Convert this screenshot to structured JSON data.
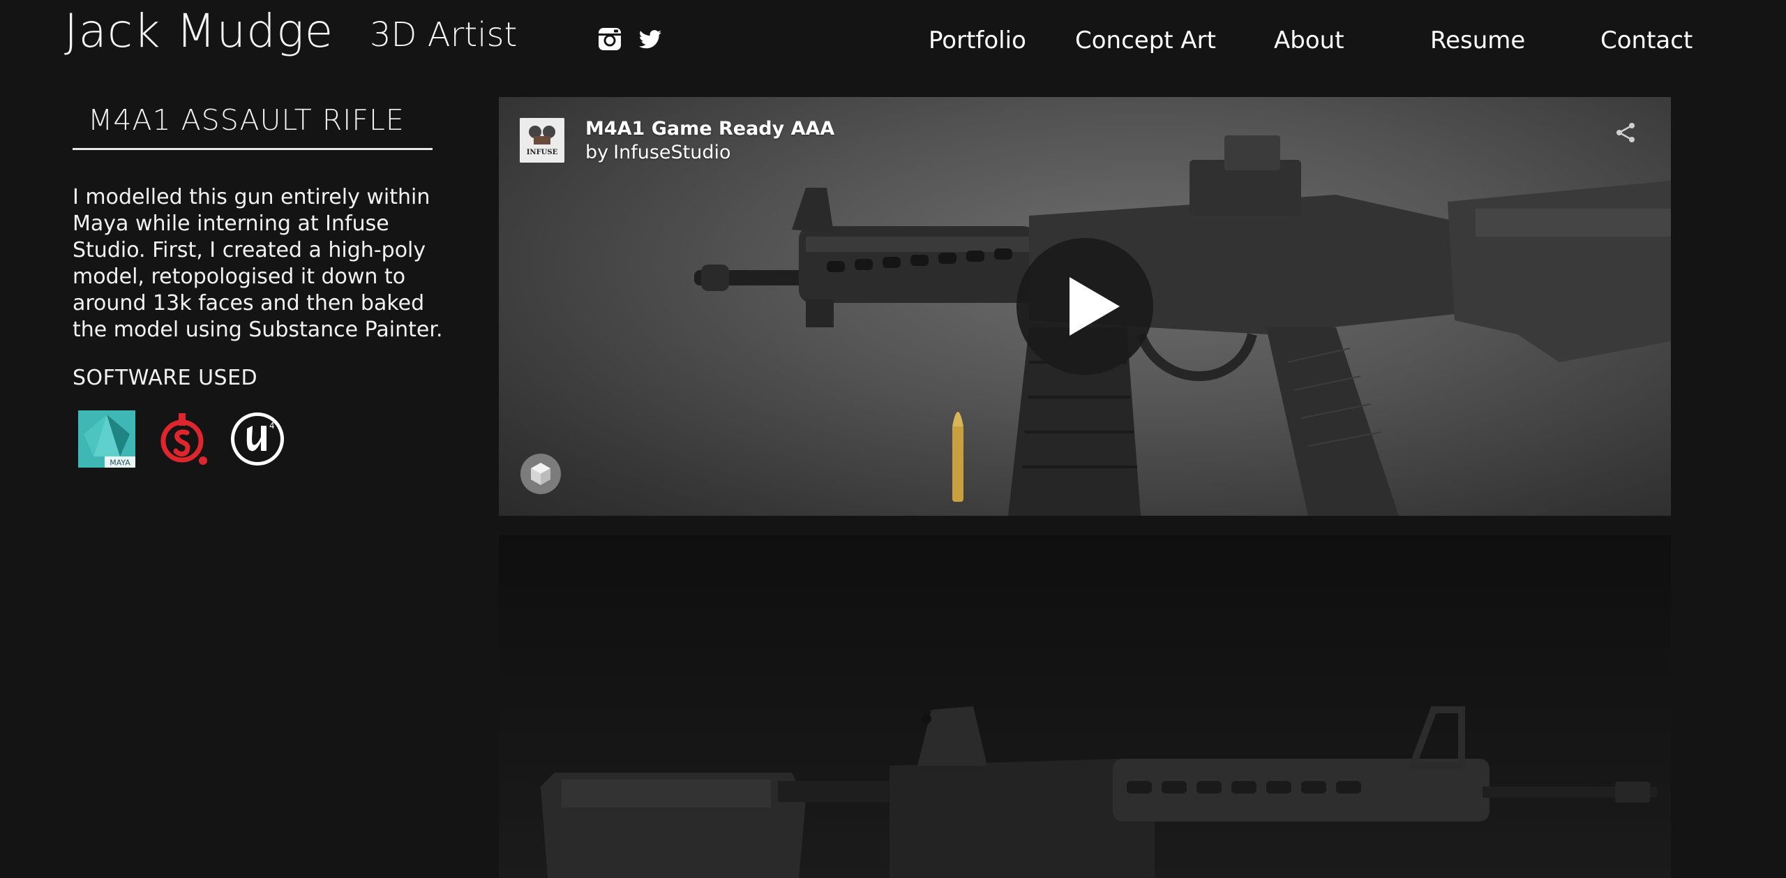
{
  "header": {
    "site_name": "Jack Mudge",
    "tagline": "3D Artist",
    "social": [
      {
        "name": "instagram",
        "icon": "instagram-icon"
      },
      {
        "name": "twitter",
        "icon": "twitter-icon"
      }
    ],
    "nav": [
      {
        "label": "Portfolio"
      },
      {
        "label": "Concept Art"
      },
      {
        "label": "About"
      },
      {
        "label": "Resume"
      },
      {
        "label": "Contact"
      }
    ]
  },
  "project": {
    "title": "M4A1 ASSAULT RIFLE",
    "description": "I modelled this gun entirely within Maya while interning at Infuse Studio. First, I created a high-poly model, retopologised it down to around 13k faces and then baked the model using Substance Painter.",
    "software_heading": "SOFTWARE USED",
    "software": [
      {
        "name": "Maya",
        "icon": "maya-icon",
        "label": "MAYA",
        "color": "#3fb7b4"
      },
      {
        "name": "Substance Painter",
        "icon": "substance-painter-icon",
        "color": "#e0262d"
      },
      {
        "name": "Unreal Engine 4",
        "icon": "unreal-engine-icon",
        "label": "4",
        "color": "#ffffff"
      }
    ]
  },
  "embed": {
    "model_title": "M4A1 Game Ready AAA",
    "by_prefix": "by",
    "author": "InfuseStudio",
    "avatar_text": "INFUSE",
    "icons": [
      "share-icon",
      "play-icon",
      "3d-cube-icon"
    ]
  },
  "colors": {
    "background": "#141414",
    "text": "#ffffff",
    "embed_bg": "#555555"
  }
}
